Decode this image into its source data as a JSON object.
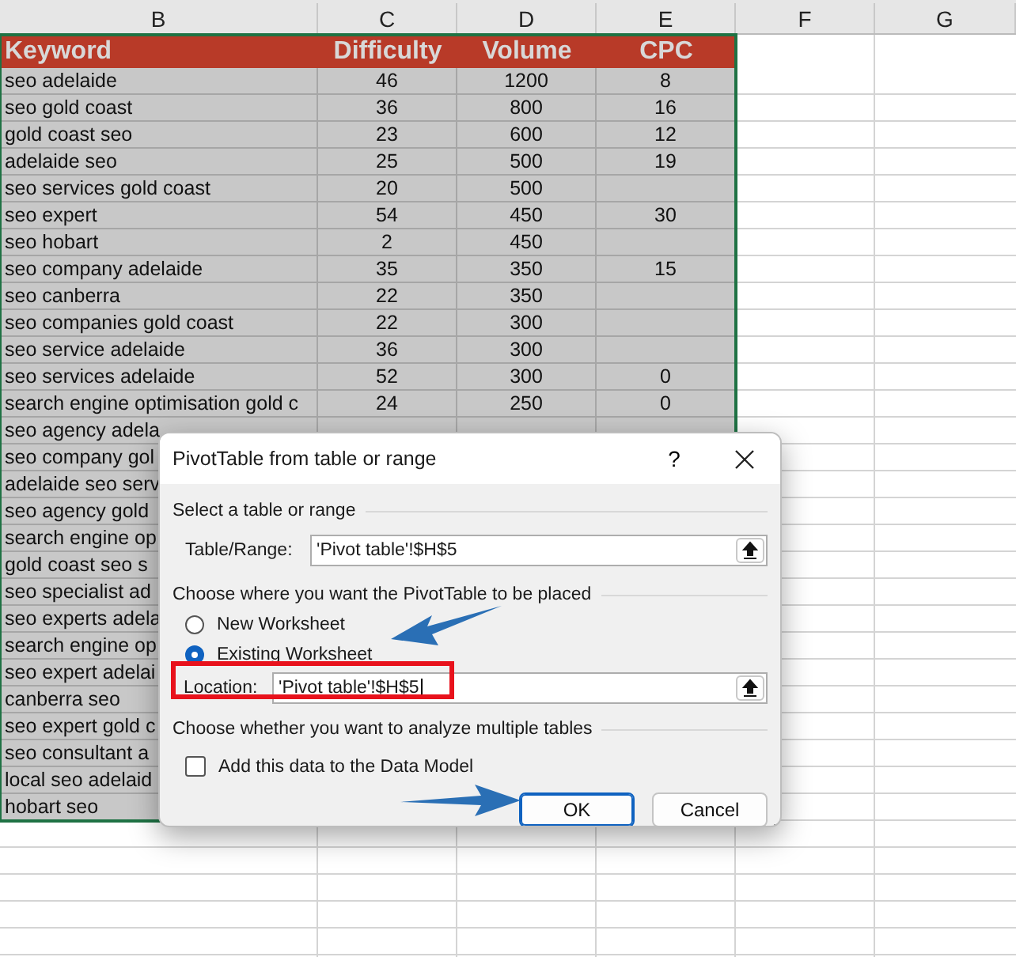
{
  "columns": [
    "B",
    "C",
    "D",
    "E",
    "F",
    "G"
  ],
  "table": {
    "header": [
      "Keyword",
      "Difficulty",
      "Volume",
      "CPC"
    ],
    "rows": [
      {
        "keyword": "seo adelaide",
        "difficulty": "46",
        "volume": "1200",
        "cpc": "8"
      },
      {
        "keyword": "seo gold coast",
        "difficulty": "36",
        "volume": "800",
        "cpc": "16"
      },
      {
        "keyword": "gold coast seo",
        "difficulty": "23",
        "volume": "600",
        "cpc": "12"
      },
      {
        "keyword": "adelaide seo",
        "difficulty": "25",
        "volume": "500",
        "cpc": "19"
      },
      {
        "keyword": "seo services gold coast",
        "difficulty": "20",
        "volume": "500"
      },
      {
        "keyword": "seo expert",
        "difficulty": "54",
        "volume": "450",
        "cpc": "30"
      },
      {
        "keyword": "seo hobart",
        "difficulty": "2",
        "volume": "450"
      },
      {
        "keyword": "seo company adelaide",
        "difficulty": "35",
        "volume": "350",
        "cpc": "15"
      },
      {
        "keyword": "seo canberra",
        "difficulty": "22",
        "volume": "350"
      },
      {
        "keyword": "seo companies gold coast",
        "difficulty": "22",
        "volume": "300"
      },
      {
        "keyword": "seo service adelaide",
        "difficulty": "36",
        "volume": "300"
      },
      {
        "keyword": "seo services adelaide",
        "difficulty": "52",
        "volume": "300",
        "cpc": "0"
      },
      {
        "keyword": "search engine optimisation gold c",
        "difficulty": "24",
        "volume": "250",
        "cpc": "0"
      },
      {
        "keyword": "seo agency adela"
      },
      {
        "keyword": "seo company gol"
      },
      {
        "keyword": "adelaide seo serv"
      },
      {
        "keyword": "seo agency gold"
      },
      {
        "keyword": "search engine op"
      },
      {
        "keyword": "gold coast seo s"
      },
      {
        "keyword": "seo specialist ad"
      },
      {
        "keyword": "seo experts adela"
      },
      {
        "keyword": "search engine op"
      },
      {
        "keyword": "seo expert adelai"
      },
      {
        "keyword": "canberra seo"
      },
      {
        "keyword": "seo expert gold c"
      },
      {
        "keyword": "seo consultant a"
      },
      {
        "keyword": "local seo adelaid"
      },
      {
        "keyword": "hobart seo"
      }
    ]
  },
  "dialog": {
    "title": "PivotTable from table or range",
    "help": "?",
    "section_1": "Select a table or range",
    "range_label": "Table/Range:",
    "range_value": "'Pivot table'!$H$5",
    "section_2": "Choose where you want the PivotTable to be placed",
    "placement_options": [
      {
        "label": "New Worksheet",
        "selected": false
      },
      {
        "label": "Existing Worksheet",
        "selected": true
      }
    ],
    "location_label": "Location:",
    "location_value": "'Pivot table'!$H$5",
    "section_3": "Choose whether you want to analyze multiple tables",
    "data_model": {
      "label": "Add this data to the Data Model",
      "checked": false
    },
    "buttons": [
      {
        "label": "OK",
        "default": true
      },
      {
        "label": "Cancel",
        "default": false
      }
    ]
  }
}
